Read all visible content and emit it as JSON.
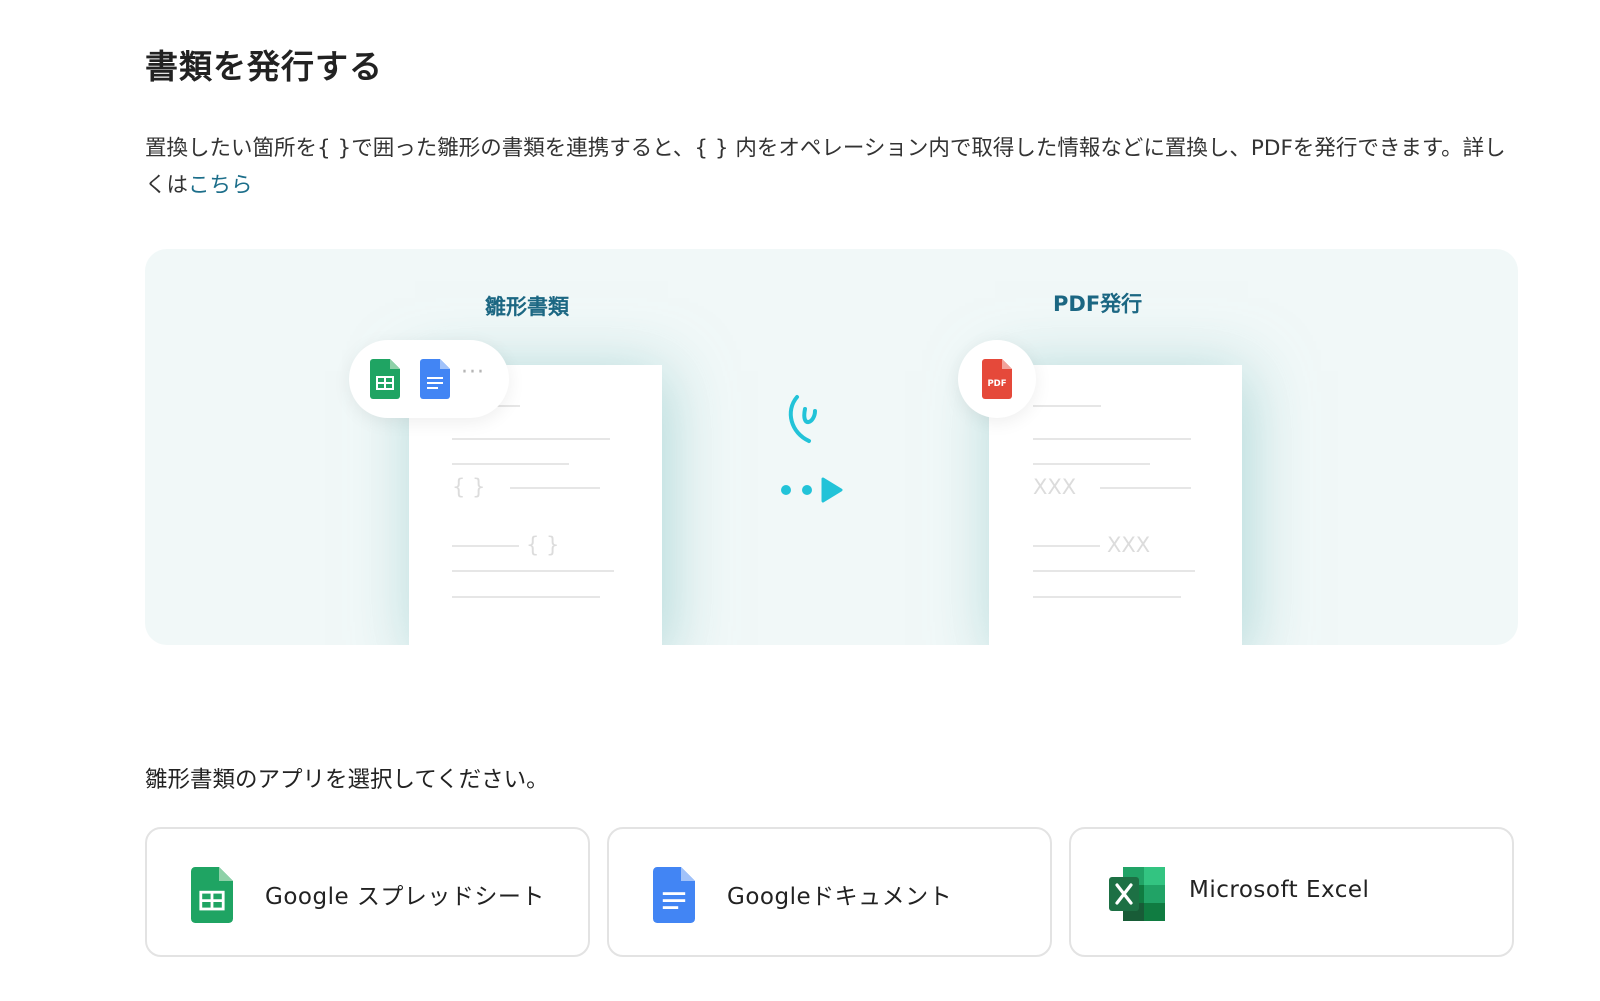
{
  "page": {
    "title": "書類を発行する",
    "description_main": "置換したい箇所を{ }で囲った雛形の書類を連携すると、{ } 内をオペレーション内で取得した情報などに置換し、PDFを発行できます。詳しくは",
    "description_link": "こちら"
  },
  "illustration": {
    "template_label": "雛形書類",
    "pdf_label": "PDF発行",
    "more_dots": "···",
    "pdf_badge": "PDF",
    "template_placeholder_1": "{     }",
    "template_placeholder_2": "{     }",
    "pdf_placeholder_1": "XXX",
    "pdf_placeholder_2": "XXX"
  },
  "selection": {
    "prompt": "雛形書類のアプリを選択してください。",
    "options": [
      {
        "label": "Google スプレッドシート",
        "icon": "google-sheets-icon"
      },
      {
        "label": "Googleドキュメント",
        "icon": "google-docs-icon"
      },
      {
        "label": "Microsoft Excel",
        "icon": "microsoft-excel-icon"
      }
    ]
  },
  "colors": {
    "link": "#1c6e8a",
    "hero_background": "#f1f8f8",
    "accent_cyan": "#22c3d8",
    "sheets_green": "#1fa463",
    "docs_blue": "#4285f4",
    "pdf_red": "#e5493a",
    "excel_green": "#1d7044"
  }
}
